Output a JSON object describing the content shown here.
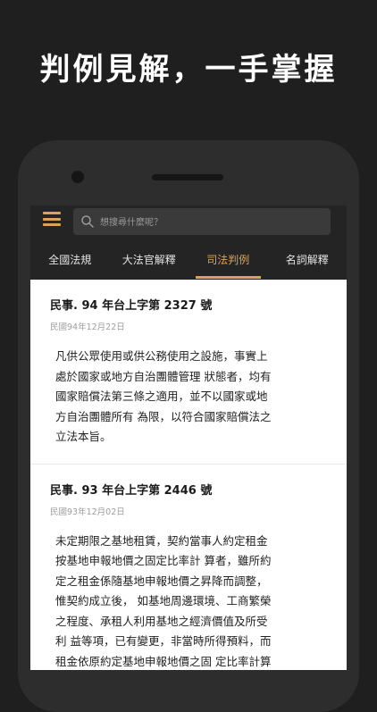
{
  "headline": "判例見解，一手掌握",
  "search": {
    "placeholder": "想搜尋什麼呢？"
  },
  "tabs": [
    {
      "label": "全國法規",
      "active": false
    },
    {
      "label": "大法官解釋",
      "active": false
    },
    {
      "label": "司法判例",
      "active": true
    },
    {
      "label": "名詞解釋",
      "active": false
    }
  ],
  "cases": [
    {
      "title": "民事. 94 年台上字第 2327 號",
      "date": "民國94年12月22日",
      "body": "凡供公眾使用或供公務使用之設施，事實上\n處於國家或地方自治團體管理 狀態者，均有\n國家賠償法第三條之適用，並不以國家或地\n方自治團體所有 為限，以符合國家賠償法之\n立法本旨。"
    },
    {
      "title": "民事. 93 年台上字第 2446 號",
      "date": "民國93年12月02日",
      "body": "未定期限之基地租賃，契約當事人約定租金\n按基地申報地價之固定比率計 算者，雖所約\n定之租金係隨基地申報地價之昇降而調整，\n惟契約成立後， 如基地周邊環境、工商繁榮\n之程度、承租人利用基地之經濟價值及所受\n利 益等項，已有變更，非當時所得預料，而\n租金依原約定基地申報地價之固 定比率計算\n顯失公平者，出租人自得依民法第二百二十\n七條之二第一項規 定，訴請法院調整其租"
    }
  ],
  "colors": {
    "accent": "#d9a35a",
    "background": "#1f1f1f",
    "card": "#ffffff"
  }
}
